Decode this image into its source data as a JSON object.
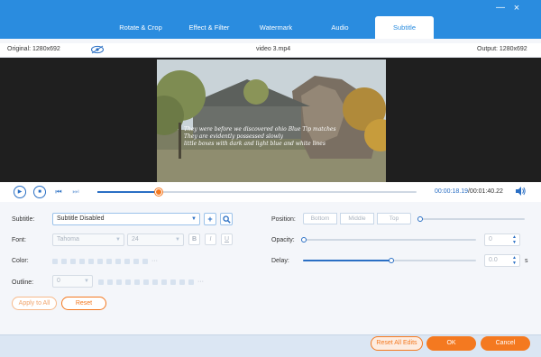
{
  "window": {
    "close_label": "×"
  },
  "tabs": [
    {
      "label": "Rotate & Crop"
    },
    {
      "label": "Effect & Filter"
    },
    {
      "label": "Watermark"
    },
    {
      "label": "Audio"
    },
    {
      "label": "Subtitle"
    }
  ],
  "info": {
    "original": "Original: 1280x692",
    "filename": "video 3.mp4",
    "output": "Output: 1280x692"
  },
  "video": {
    "subtitle_lines": [
      "They were before we discovered ohio Blue Tip matches",
      "They are evidently possessed slowly",
      "little boxes with dark and light blue and white lines"
    ]
  },
  "playback": {
    "time_current": "00:00:18.19",
    "time_total": "/00:01:40.22",
    "progress": 0.19
  },
  "settings": {
    "subtitle_label": "Subtitle:",
    "subtitle_value": "Subtitle Disabled",
    "font_label": "Font:",
    "font_value": "Tahoma",
    "font_size": "24",
    "bold": "B",
    "italic": "I",
    "underline": "U",
    "color_label": "Color:",
    "outline_label": "Outline:",
    "outline_value": "0",
    "position_label": "Position:",
    "position_options": [
      "Bottom",
      "Middle",
      "Top"
    ],
    "opacity_label": "Opacity:",
    "opacity_value": "0",
    "delay_label": "Delay:",
    "delay_value": "0.0",
    "delay_unit": "s",
    "ellipsis": "···",
    "apply_all": "Apply to All",
    "reset": "Reset"
  },
  "footer": {
    "reset_all": "Reset All Edits",
    "ok": "OK",
    "cancel": "Cancel"
  },
  "colors": {
    "accent": "#2a8cdf",
    "orange": "#f47920",
    "dark_blue": "#2a6fc4"
  }
}
